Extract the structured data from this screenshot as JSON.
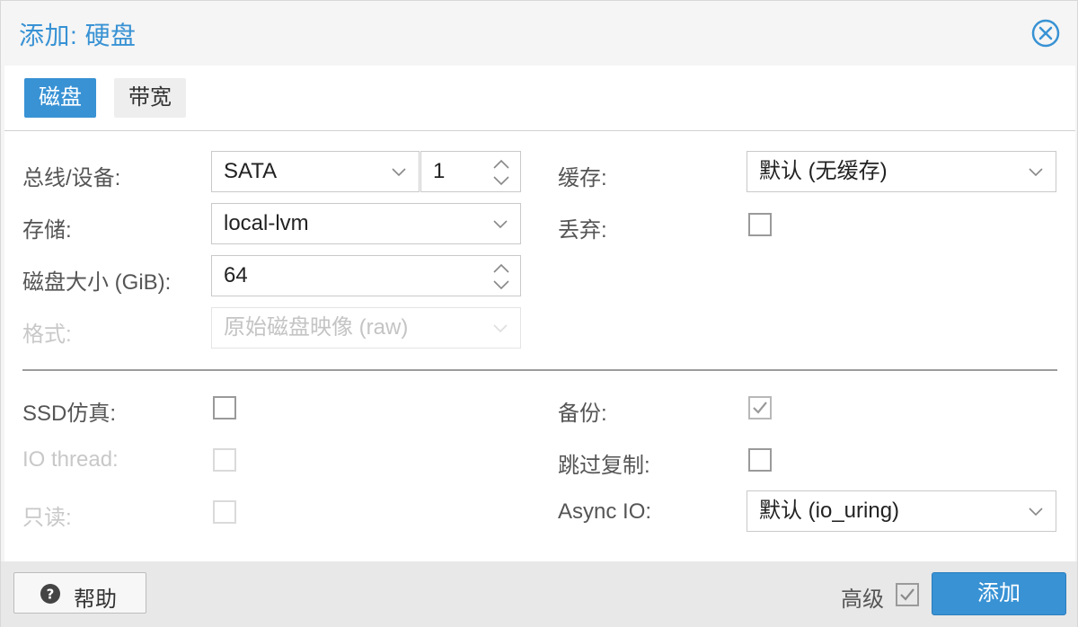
{
  "dialog": {
    "title": "添加: 硬盘"
  },
  "tabs": [
    {
      "label": "磁盘",
      "active": true
    },
    {
      "label": "带宽",
      "active": false
    }
  ],
  "form": {
    "bus_device": {
      "label": "总线/设备:",
      "bus_value": "SATA",
      "device_value": "1"
    },
    "storage": {
      "label": "存储:",
      "value": "local-lvm"
    },
    "disk_size": {
      "label": "磁盘大小 (GiB):",
      "value": "64"
    },
    "format": {
      "label": "格式:",
      "value": "原始磁盘映像 (raw)",
      "disabled": true
    },
    "cache": {
      "label": "缓存:",
      "value": "默认 (无缓存)"
    },
    "discard": {
      "label": "丢弃:",
      "checked": false
    },
    "ssd_emulation": {
      "label": "SSD仿真:",
      "checked": false
    },
    "io_thread": {
      "label": "IO thread:",
      "checked": false,
      "disabled": true
    },
    "read_only": {
      "label": "只读:",
      "checked": false,
      "disabled": true
    },
    "backup": {
      "label": "备份:",
      "checked": true,
      "disabled": true
    },
    "skip_replication": {
      "label": "跳过复制:",
      "checked": false
    },
    "async_io": {
      "label": "Async IO:",
      "value": "默认 (io_uring)"
    }
  },
  "footer": {
    "help_label": "帮助",
    "advanced_label": "高级",
    "advanced_checked": true,
    "add_label": "添加"
  },
  "colors": {
    "accent": "#3892d4",
    "disabled_text": "#c8c8c8"
  },
  "icons": {
    "close": "close-circle-icon",
    "help": "question-circle-icon",
    "dropdown": "chevron-down-icon",
    "spinner": "spinner-arrows-icon",
    "check": "checkmark-icon"
  }
}
